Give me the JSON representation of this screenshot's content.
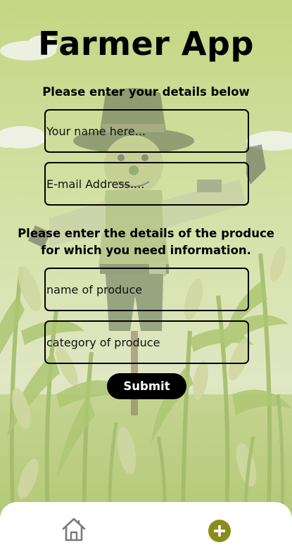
{
  "app": {
    "title": "Farmer App"
  },
  "personal_section": {
    "heading": "Please enter your details below",
    "name_placeholder": "Your name here...",
    "email_placeholder": "E-mail Address...."
  },
  "produce_section": {
    "heading": "Please enter the details of the produce for which you need information.",
    "produce_name_placeholder": "name of produce",
    "produce_category_placeholder": "category of produce"
  },
  "actions": {
    "submit_label": "Submit"
  },
  "tabbar": {
    "items": [
      {
        "icon": "home-icon",
        "selected": false
      },
      {
        "icon": "add-circle-icon",
        "selected": true
      }
    ],
    "accent_color": "#8a8d1b"
  },
  "colors": {
    "background_tint": "#c9d98f",
    "field_border": "#000000",
    "submit_background": "#000000",
    "submit_text": "#ffffff"
  }
}
